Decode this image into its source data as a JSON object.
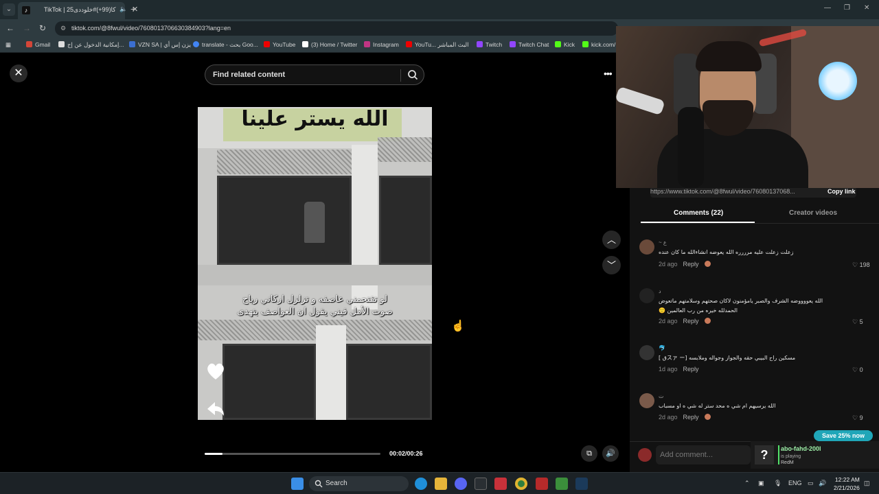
{
  "browser": {
    "tab_title": "TikTok | 25کا(99+)#خلوددی",
    "url": "tiktok.com/@8fwul/video/7608013706630384903?lang=en",
    "bookmarks": [
      {
        "label": "Gmail",
        "color": "#d44638"
      },
      {
        "label": "إمكانية الدخول عن إج...",
        "color": "#ddd"
      },
      {
        "label": "VZN SA | يزن إس أي",
        "color": "#3b6fd1"
      },
      {
        "label": "translate - بحث Goo...",
        "color": "#4285f4"
      },
      {
        "label": "YouTube",
        "color": "#e00"
      },
      {
        "label": "(3) Home / Twitter",
        "color": "#fff"
      },
      {
        "label": "Instagram",
        "color": "#c13584"
      },
      {
        "label": "YouTu... البث المباشر",
        "color": "#e00"
      },
      {
        "label": "Twitch",
        "color": "#9146ff"
      },
      {
        "label": "Twitch Chat",
        "color": "#9146ff"
      },
      {
        "label": "Kick",
        "color": "#53fc18"
      },
      {
        "label": "kick.com/",
        "color": "#53fc18"
      }
    ]
  },
  "page": {
    "search_placeholder": "Find related content",
    "video": {
      "title_text": "الله يستر علينا",
      "subtitle_line1": "لو تقتحمني عاصفه و تزلزل اركاني رياح",
      "subtitle_line2": "صوت الأمل فيني يقول ان العواصف بتهدى",
      "progress_fraction": 0.1,
      "time": "00:02/00:26"
    }
  },
  "panel": {
    "link_text": "https://www.tiktok.com/@8fwul/video/76080137068...",
    "copy_label": "Copy link",
    "tab_comments": "Comments (22)",
    "tab_creator": "Creator videos",
    "comments": [
      {
        "user": "~ ع",
        "text": "زعلت زعلت عليه مرررره الله يعوضه انشاءالله ما كان عنده",
        "age": "2d ago",
        "reply": "Reply",
        "likes": "198",
        "avatar": "#6a4a3a"
      },
      {
        "user": "د",
        "text": "الله يعووووضه الشرف والصبر يامؤمنون لاكان صحتهم وسلامتهم ماتعوض الحمدلله خيره من رب العالمين 🙂",
        "age": "2d ago",
        "reply": "Reply",
        "likes": "5",
        "avatar": "#222"
      },
      {
        "user": "🐬",
        "text": "مسكين راح البيبي حقه والجواز وجواله وملابسه [スァ ーق ]",
        "age": "1d ago",
        "reply": "Reply",
        "likes": "0",
        "avatar": "#333"
      },
      {
        "user": "ت",
        "text": "الله يرسيهم ام شي ه محد ستر له شي ه او مسباب",
        "age": "2d ago",
        "reply": "Reply",
        "likes": "9",
        "avatar": "#7a5a4a"
      }
    ],
    "save_label": "Save 25% now",
    "add_comment_placeholder": "Add comment..."
  },
  "alert": {
    "name": "abo-fahd-200l",
    "status": "is playing",
    "game": "RedM"
  },
  "taskbar": {
    "search_label": "Search",
    "lang": "ENG",
    "time": "12:22 AM",
    "date": "2/21/2026"
  }
}
